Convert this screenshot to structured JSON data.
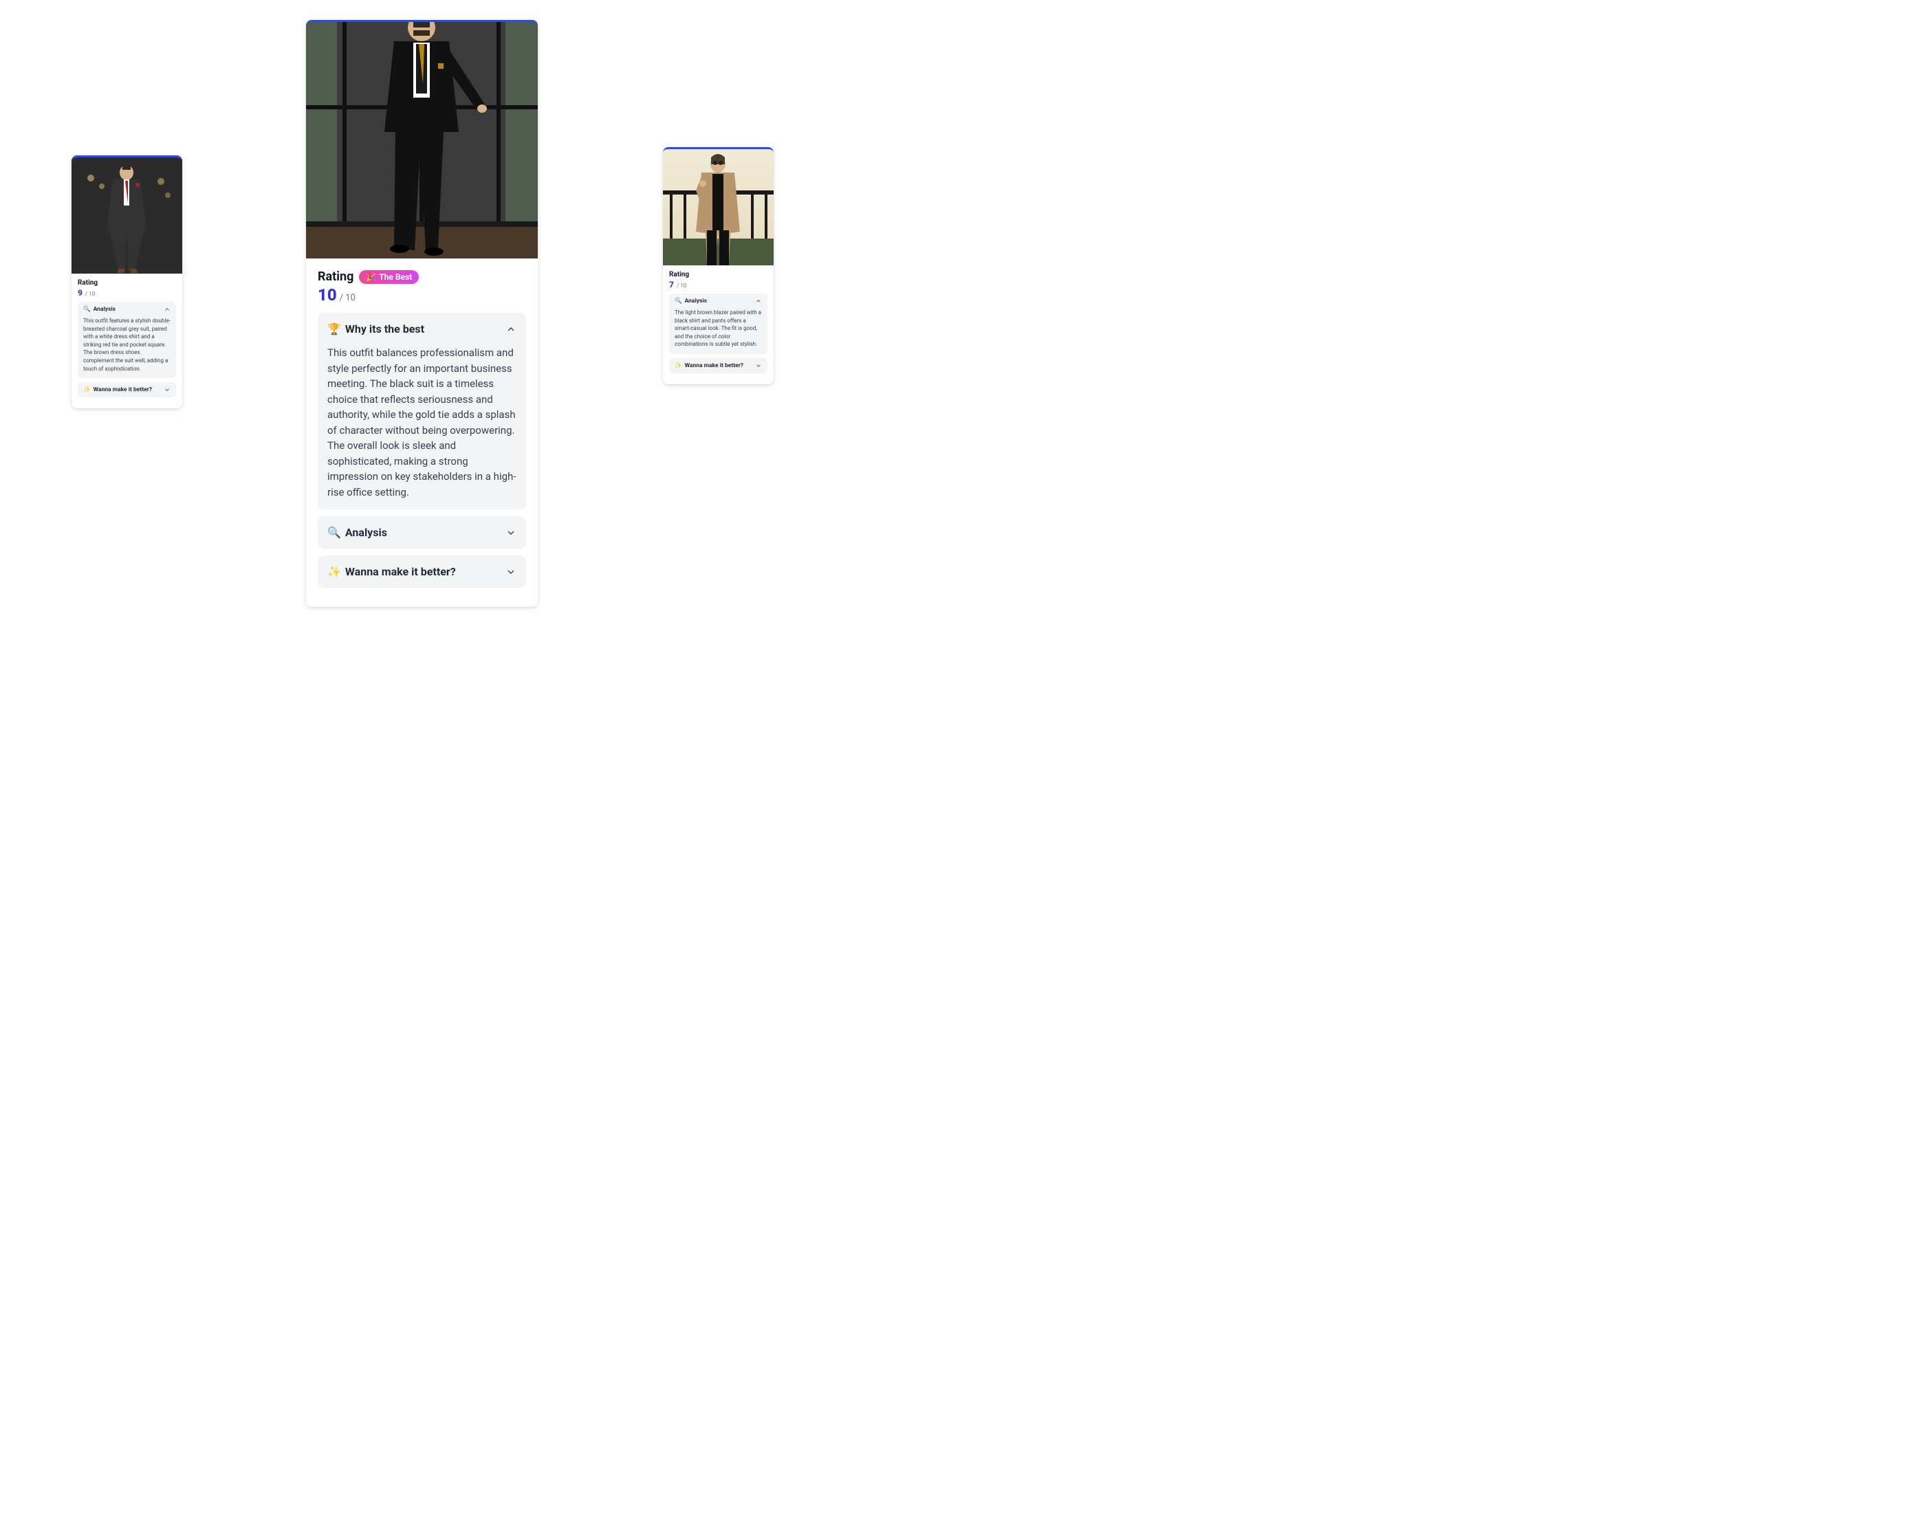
{
  "ratingLabel": "Rating",
  "denom": "/ 10",
  "badge": {
    "emoji": "🎉",
    "text": "The Best"
  },
  "sections": {
    "whyBest": {
      "emoji": "🏆",
      "label": "Why its the best"
    },
    "analysis": {
      "emoji": "🔍",
      "label": "Analysis"
    },
    "better": {
      "emoji": "✨",
      "label": "Wanna make it better?"
    }
  },
  "cards": [
    {
      "score": "9",
      "analysisText": "This outfit features a stylish double-breasted charcoal grey suit, paired with a white dress shirt and a striking red tie and pocket square. The brown dress shoes complement the suit well, adding a touch of sophistication."
    },
    {
      "score": "10",
      "whyBestText": "This outfit balances professionalism and style perfectly for an important business meeting. The black suit is a timeless choice that reflects seriousness and authority, while the gold tie adds a splash of character without being overpowering. The overall look is sleek and sophisticated, making a strong impression on key stakeholders in a high-rise office setting."
    },
    {
      "score": "7",
      "analysisText": "The light brown blazer paired with a black shirt and pants offers a smart-casual look. The fit is good, and the choice of color combinations is subtle yet stylish."
    }
  ]
}
